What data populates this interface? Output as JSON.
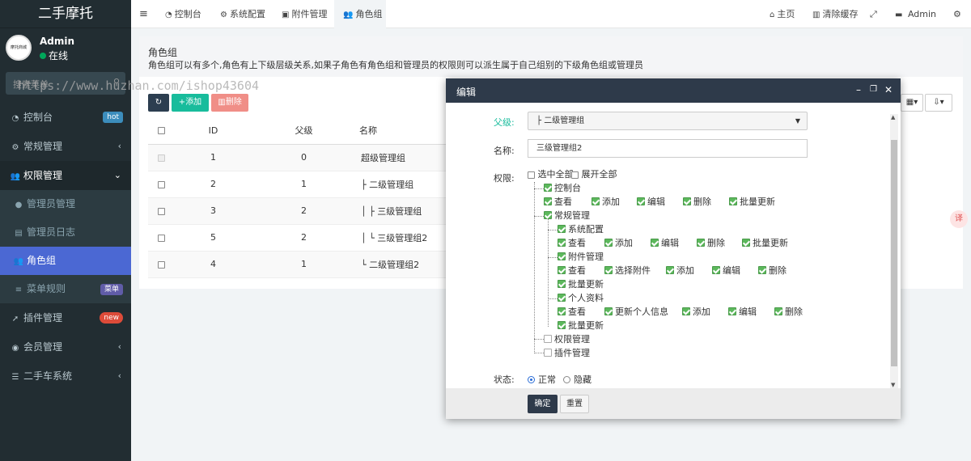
{
  "app": {
    "title": "二手摩托"
  },
  "user": {
    "name": "Admin",
    "status": "在线",
    "avatar_text": "摩托商城"
  },
  "search": {
    "placeholder": "搜索菜单"
  },
  "watermark": "https://www.huzhan.com/ishop43604",
  "sidebar": {
    "items": [
      {
        "label": "控制台",
        "icon": "dashboard-icon",
        "badge": "hot",
        "badge_color": "#3c8dbc"
      },
      {
        "label": "常规管理",
        "icon": "cogs-icon",
        "arrow": "‹"
      },
      {
        "label": "权限管理",
        "icon": "users-icon",
        "arrow": "⌄"
      },
      {
        "label": "管理员管理",
        "icon": "user-icon"
      },
      {
        "label": "管理员日志",
        "icon": "list-alt-icon"
      },
      {
        "label": "角色组",
        "icon": "group-icon"
      },
      {
        "label": "菜单规则",
        "icon": "bars-icon",
        "badge": "菜单",
        "badge_color": "#605ca8"
      },
      {
        "label": "插件管理",
        "icon": "rocket-icon",
        "badge": "new",
        "badge_color": "#dd4b39"
      },
      {
        "label": "会员管理",
        "icon": "user-circle-icon",
        "arrow": "‹"
      },
      {
        "label": "二手车系统",
        "icon": "list-icon",
        "arrow": "‹"
      }
    ]
  },
  "topbar": {
    "tabs": [
      {
        "label": "控制台",
        "icon": "dashboard-icon"
      },
      {
        "label": "系统配置",
        "icon": "gear-icon"
      },
      {
        "label": "附件管理",
        "icon": "file-image-icon"
      },
      {
        "label": "角色组",
        "icon": "users-icon"
      }
    ],
    "home": "主页",
    "clear_cache": "清除缓存",
    "admin": "Admin"
  },
  "page": {
    "title": "角色组",
    "description": "角色组可以有多个,角色有上下级层级关系,如果子角色有角色组和管理员的权限则可以派生属于自己组别的下级角色组或管理员"
  },
  "toolbar": {
    "add": "添加",
    "delete": "删除"
  },
  "table": {
    "headers": [
      "ID",
      "父级",
      "名称"
    ],
    "rows": [
      {
        "id": "1",
        "pid": "0",
        "name": "超级管理组"
      },
      {
        "id": "2",
        "pid": "1",
        "name": "├ 二级管理组"
      },
      {
        "id": "3",
        "pid": "2",
        "name": "│ ├ 三级管理组"
      },
      {
        "id": "5",
        "pid": "2",
        "name": "│ └ 三级管理组2"
      },
      {
        "id": "4",
        "pid": "1",
        "name": "└ 二级管理组2"
      }
    ]
  },
  "modal": {
    "title": "编辑",
    "parent_label": "父级:",
    "parent_value": "├ 二级管理组",
    "name_label": "名称:",
    "name_value": "三级管理组2",
    "perm_label": "权限:",
    "select_all": "选中全部",
    "expand_all": "展开全部",
    "status_label": "状态:",
    "status_normal": "正常",
    "status_hidden": "隐藏",
    "confirm": "确定",
    "reset": "重置"
  },
  "tree": {
    "dashboard": "控制台",
    "dashboard_children": [
      "查看",
      "添加",
      "编辑",
      "删除",
      "批量更新"
    ],
    "general": "常规管理",
    "config": "系统配置",
    "config_children": [
      "查看",
      "添加",
      "编辑",
      "删除",
      "批量更新"
    ],
    "attachment": "附件管理",
    "attachment_children": [
      "查看",
      "选择附件",
      "添加",
      "编辑",
      "删除",
      "批量更新"
    ],
    "profile": "个人资料",
    "profile_children": [
      "查看",
      "更新个人信息",
      "添加",
      "编辑",
      "删除",
      "批量更新"
    ],
    "auth": "权限管理",
    "addon": "插件管理"
  },
  "colors": {
    "sidebar": "#222d32",
    "active": "#4b68d3",
    "modal_head": "#2e3a4a",
    "green": "#5cb85c"
  }
}
